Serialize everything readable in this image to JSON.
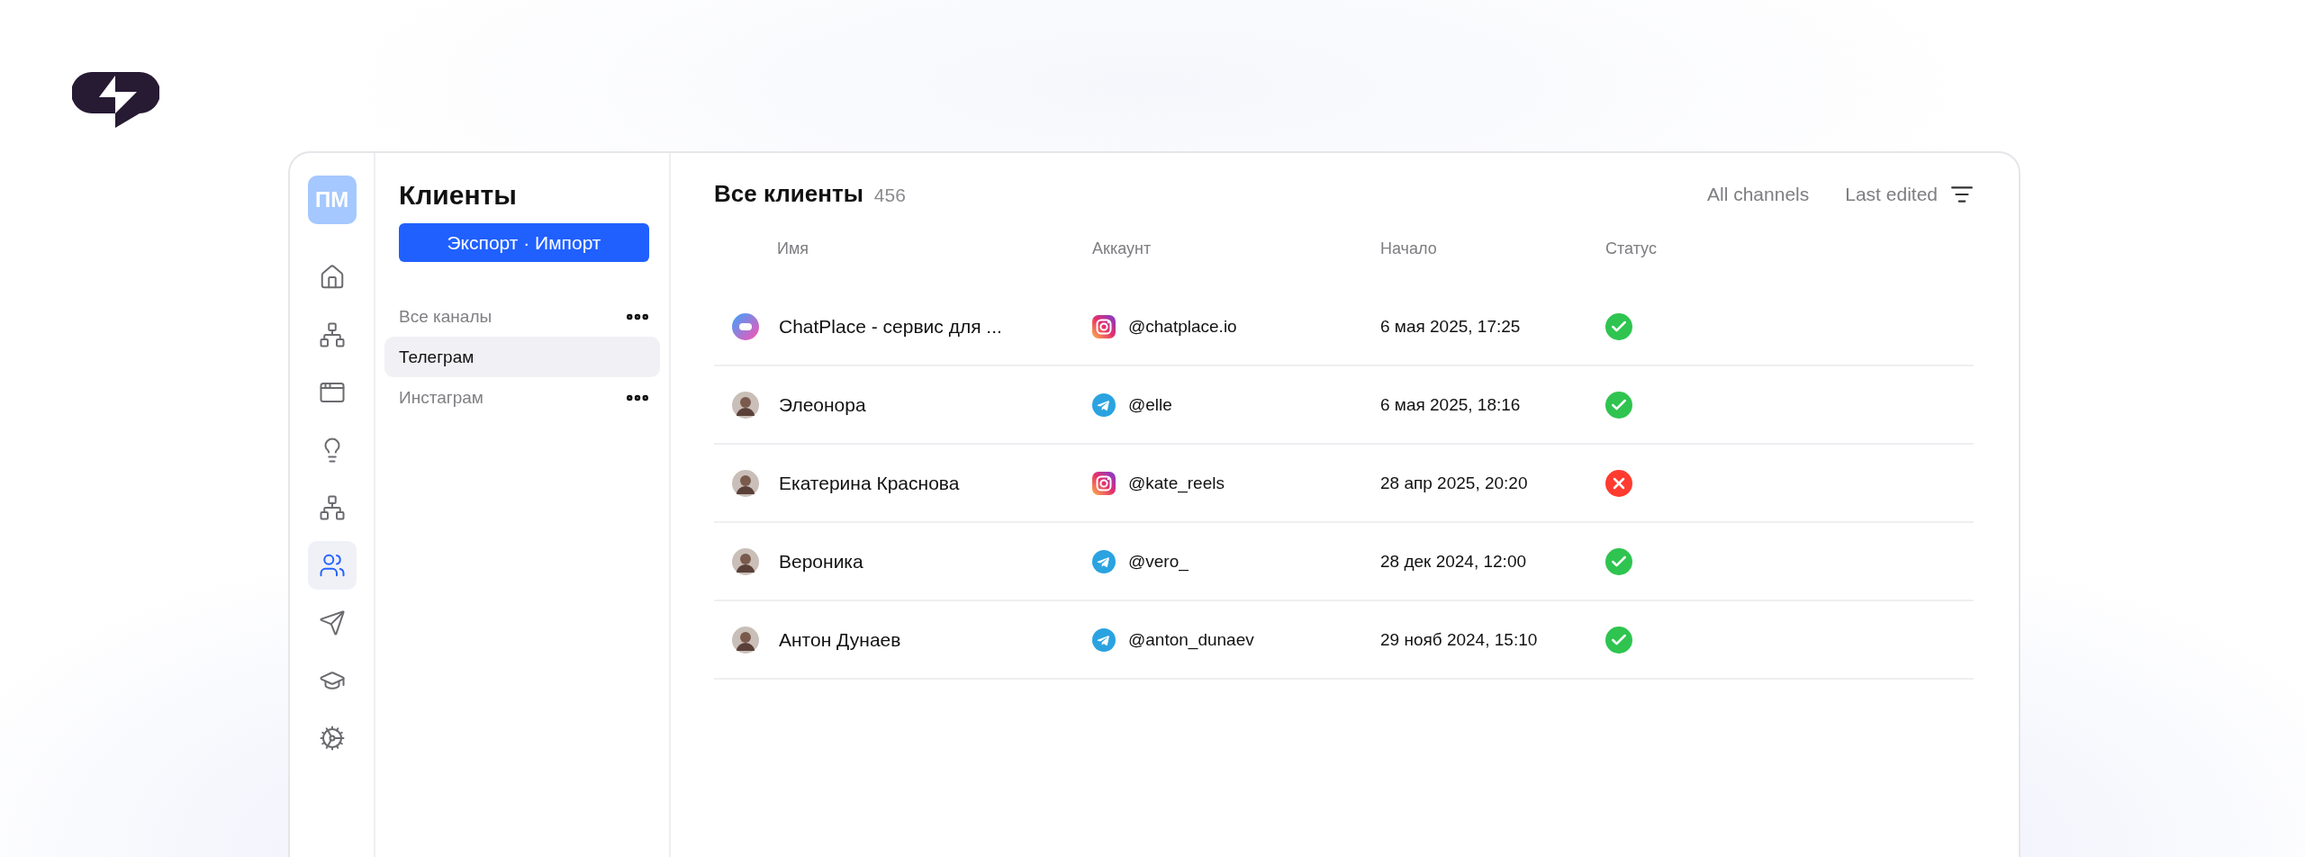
{
  "rail": {
    "avatar": "ПМ",
    "items": [
      {
        "kind": "home",
        "selected": false
      },
      {
        "kind": "network",
        "selected": false
      },
      {
        "kind": "layout",
        "selected": false
      },
      {
        "kind": "idea",
        "selected": false
      },
      {
        "kind": "network",
        "selected": false
      },
      {
        "kind": "users",
        "selected": true
      },
      {
        "kind": "send",
        "selected": false
      },
      {
        "kind": "education",
        "selected": false
      },
      {
        "kind": "settings",
        "selected": false
      }
    ]
  },
  "panel": {
    "title": "Клиенты",
    "button": "Экспорт · Импорт",
    "items": [
      {
        "label": "Все каналы",
        "selected": false,
        "menu": true
      },
      {
        "label": "Телеграм",
        "selected": true,
        "menu": false
      },
      {
        "label": "Инстаграм",
        "selected": false,
        "menu": true
      }
    ]
  },
  "main": {
    "title": "Все клиенты",
    "count": "456",
    "filter": "All channels",
    "sort": "Last edited",
    "table": {
      "columns": [
        "Имя",
        "Аккаунт",
        "Начало",
        "Статус"
      ],
      "rows": [
        {
          "avatar": {
            "kind": "logo"
          },
          "name": "ChatPlace - сервис для ...",
          "channel": {
            "kind": "instagram"
          },
          "account": "@chatplace.io",
          "start": "6 мая 2025, 17:25",
          "status": {
            "kind": "ok"
          }
        },
        {
          "avatar": {
            "kind": "photo"
          },
          "name": "Элеонора",
          "channel": {
            "kind": "telegram"
          },
          "account": "@elle",
          "start": "6 мая 2025, 18:16",
          "status": {
            "kind": "ok"
          }
        },
        {
          "avatar": {
            "kind": "photo"
          },
          "name": "Екатерина Краснова",
          "channel": {
            "kind": "instagram"
          },
          "account": "@kate_reels",
          "start": "28 апр 2025, 20:20",
          "status": {
            "kind": "error"
          }
        },
        {
          "avatar": {
            "kind": "photo"
          },
          "name": "Вероника",
          "channel": {
            "kind": "telegram"
          },
          "account": "@vero_",
          "start": "28 дек 2024, 12:00",
          "status": {
            "kind": "ok"
          }
        },
        {
          "avatar": {
            "kind": "photo"
          },
          "name": "Антон Дунаев",
          "channel": {
            "kind": "telegram"
          },
          "account": "@anton_dunaev",
          "start": "29 нояб 2024, 15:10",
          "status": {
            "kind": "ok"
          }
        }
      ]
    }
  }
}
